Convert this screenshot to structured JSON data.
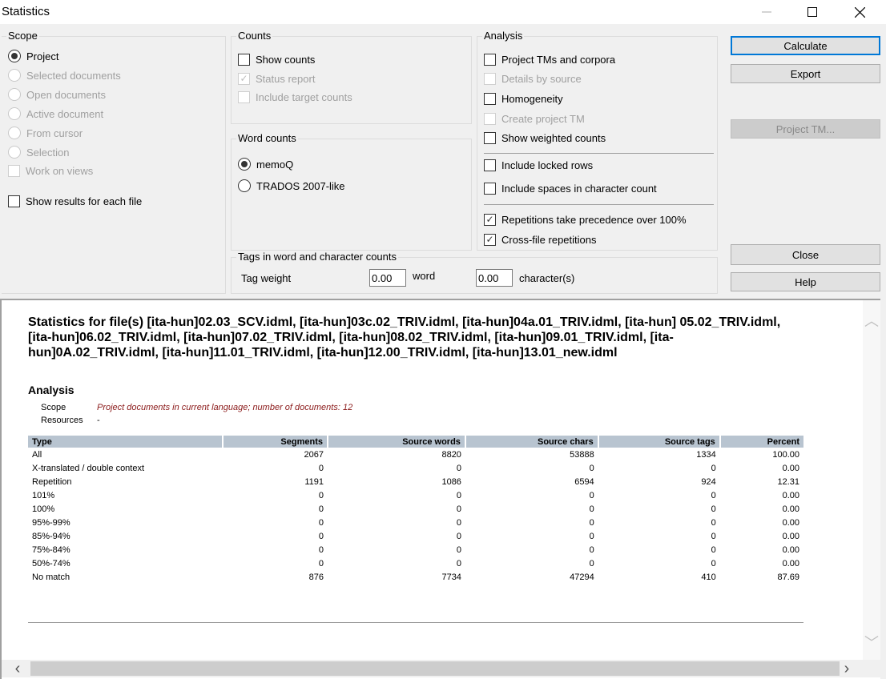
{
  "window": {
    "title": "Statistics",
    "controls": {
      "minimize": "minimize",
      "maximize": "maximize",
      "close": "close"
    }
  },
  "scope": {
    "label": "Scope",
    "options": [
      {
        "label": "Project",
        "selected": true,
        "enabled": true
      },
      {
        "label": "Selected documents",
        "selected": false,
        "enabled": false
      },
      {
        "label": "Open documents",
        "selected": false,
        "enabled": false
      },
      {
        "label": "Active document",
        "selected": false,
        "enabled": false
      },
      {
        "label": "From cursor",
        "selected": false,
        "enabled": false
      },
      {
        "label": "Selection",
        "selected": false,
        "enabled": false
      }
    ],
    "work_on_views": {
      "label": "Work on views",
      "checked": false,
      "enabled": false
    },
    "show_results_each_file": {
      "label": "Show results for each file",
      "checked": false,
      "enabled": true
    }
  },
  "counts": {
    "label": "Counts",
    "show_counts": {
      "label": "Show counts",
      "checked": false,
      "enabled": true
    },
    "status_report": {
      "label": "Status report",
      "checked": true,
      "enabled": false
    },
    "include_target_counts": {
      "label": "Include target counts",
      "checked": false,
      "enabled": false
    }
  },
  "word_counts": {
    "label": "Word counts",
    "memoq": {
      "label": "memoQ",
      "selected": true
    },
    "trados": {
      "label": "TRADOS 2007-like",
      "selected": false
    }
  },
  "analysis": {
    "label": "Analysis",
    "project_tms": {
      "label": "Project TMs and corpora",
      "checked": false,
      "enabled": true
    },
    "details_by_source": {
      "label": "Details by source",
      "checked": false,
      "enabled": false
    },
    "homogeneity": {
      "label": "Homogeneity",
      "checked": false,
      "enabled": true
    },
    "create_project_tm": {
      "label": "Create project TM",
      "checked": false,
      "enabled": false
    },
    "show_weighted": {
      "label": "Show weighted counts",
      "checked": false,
      "enabled": true
    },
    "include_locked": {
      "label": "Include locked rows",
      "checked": false,
      "enabled": true
    },
    "include_spaces": {
      "label": "Include spaces in character count",
      "checked": false,
      "enabled": true
    },
    "repetitions_precedence": {
      "label": "Repetitions take precedence over 100%",
      "checked": true,
      "enabled": true
    },
    "cross_file": {
      "label": "Cross-file repetitions",
      "checked": true,
      "enabled": true
    }
  },
  "tags": {
    "label": "Tags in word and character counts",
    "tag_weight_label": "Tag weight",
    "word_value": "0.00",
    "word_unit": "word",
    "char_value": "0.00",
    "char_unit": "character(s)"
  },
  "buttons": {
    "calculate": "Calculate",
    "export": "Export",
    "project_tm": "Project TM...",
    "close": "Close",
    "help": "Help"
  },
  "report": {
    "heading": "Statistics for file(s) [ita-hun]02.03_SCV.idml, [ita-hun]03c.02_TRIV.idml, [ita-hun]04a.01_TRIV.idml, [ita-hun] 05.02_TRIV.idml, [ita-hun]06.02_TRIV.idml, [ita-hun]07.02_TRIV.idml, [ita-hun]08.02_TRIV.idml, [ita-hun]09.01_TRIV.idml, [ita-hun]0A.02_TRIV.idml, [ita-hun]11.01_TRIV.idml, [ita-hun]12.00_TRIV.idml, [ita-hun]13.01_new.idml",
    "section_title": "Analysis",
    "scope_label": "Scope",
    "scope_value": "Project documents in current language; number of documents: 12",
    "resources_label": "Resources",
    "resources_value": "-",
    "table": {
      "columns": [
        "Type",
        "Segments",
        "Source words",
        "Source chars",
        "Source tags",
        "Percent"
      ],
      "rows": [
        [
          "All",
          "2067",
          "8820",
          "53888",
          "1334",
          "100.00"
        ],
        [
          "X-translated / double context",
          "0",
          "0",
          "0",
          "0",
          "0.00"
        ],
        [
          "Repetition",
          "1191",
          "1086",
          "6594",
          "924",
          "12.31"
        ],
        [
          "101%",
          "0",
          "0",
          "0",
          "0",
          "0.00"
        ],
        [
          "100%",
          "0",
          "0",
          "0",
          "0",
          "0.00"
        ],
        [
          "95%-99%",
          "0",
          "0",
          "0",
          "0",
          "0.00"
        ],
        [
          "85%-94%",
          "0",
          "0",
          "0",
          "0",
          "0.00"
        ],
        [
          "75%-84%",
          "0",
          "0",
          "0",
          "0",
          "0.00"
        ],
        [
          "50%-74%",
          "0",
          "0",
          "0",
          "0",
          "0.00"
        ],
        [
          "No match",
          "876",
          "7734",
          "47294",
          "410",
          "87.69"
        ]
      ]
    }
  }
}
